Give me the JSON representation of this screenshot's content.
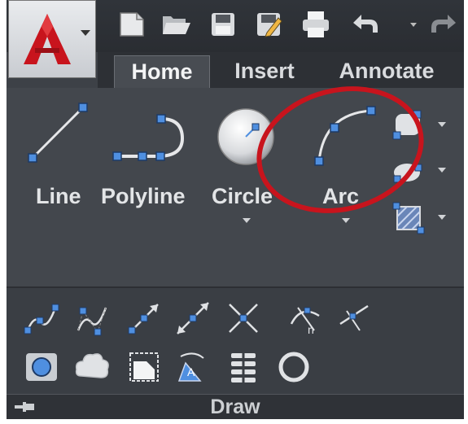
{
  "tabs": [
    {
      "label": "Home",
      "active": true
    },
    {
      "label": "Insert",
      "active": false
    },
    {
      "label": "Annotate",
      "active": false
    }
  ],
  "draw_tools": {
    "line": "Line",
    "polyline": "Polyline",
    "circle": "Circle",
    "arc": "Arc"
  },
  "panel": {
    "title": "Draw"
  },
  "colors": {
    "accent_red": "#c8141d",
    "grip_blue": "#4f8fe0",
    "panel_bg": "#43474d"
  },
  "quick_access_icons": [
    "new-icon",
    "open-icon",
    "save-icon",
    "save-as-icon",
    "plot-icon",
    "undo-icon",
    "redo-icon"
  ],
  "row1_icons": [
    "spline-fit-icon",
    "spline-cv-icon",
    "ray-icon",
    "construction-line-icon",
    "multiline-icon",
    "divide-icon",
    "measure-icon"
  ],
  "row2_icons": [
    "region-icon",
    "cloud-icon",
    "wipeout-icon",
    "3d-polyline-icon",
    "helix-icon",
    "donut-icon"
  ]
}
